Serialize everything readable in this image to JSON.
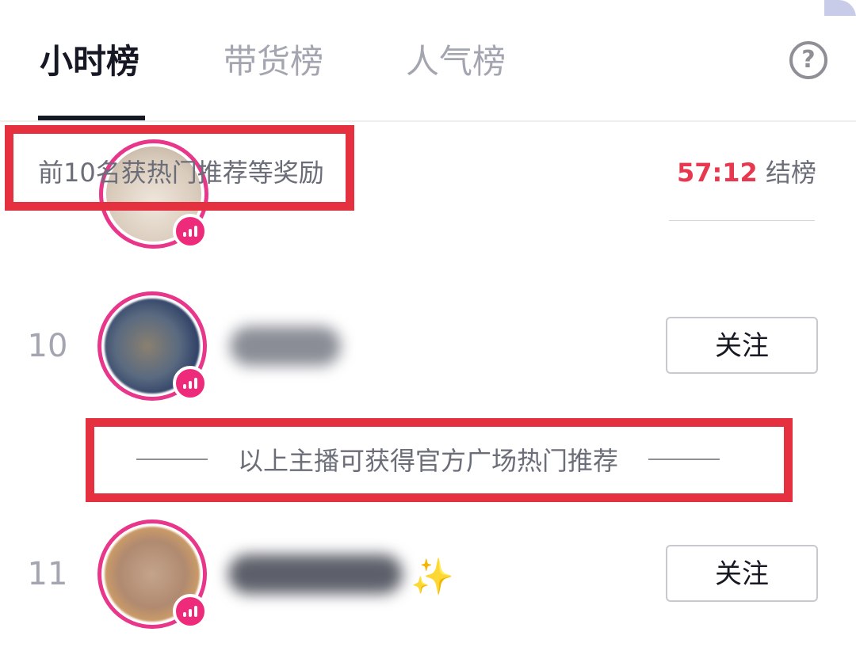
{
  "tabs": [
    {
      "label": "小时榜",
      "active": true
    },
    {
      "label": "带货榜",
      "active": false
    },
    {
      "label": "人气榜",
      "active": false
    }
  ],
  "help_icon": {
    "name": "help-icon",
    "glyph": "?"
  },
  "info": {
    "reward_text": "前10名获热门推荐等奖励",
    "countdown": "57:12",
    "countdown_label": "结榜"
  },
  "recommend_divider": "以上主播可获得官方广场热门推荐",
  "rows": [
    {
      "rank": "",
      "follow_label": ""
    },
    {
      "rank": "10",
      "follow_label": "关注"
    },
    {
      "rank": "11",
      "follow_label": "关注"
    }
  ],
  "colors": {
    "accent_red": "#e8384f",
    "live_pink": "#ee2a7b",
    "highlight_red": "#e4303f",
    "text_dark": "#161823",
    "text_gray": "#a3a6b0"
  }
}
